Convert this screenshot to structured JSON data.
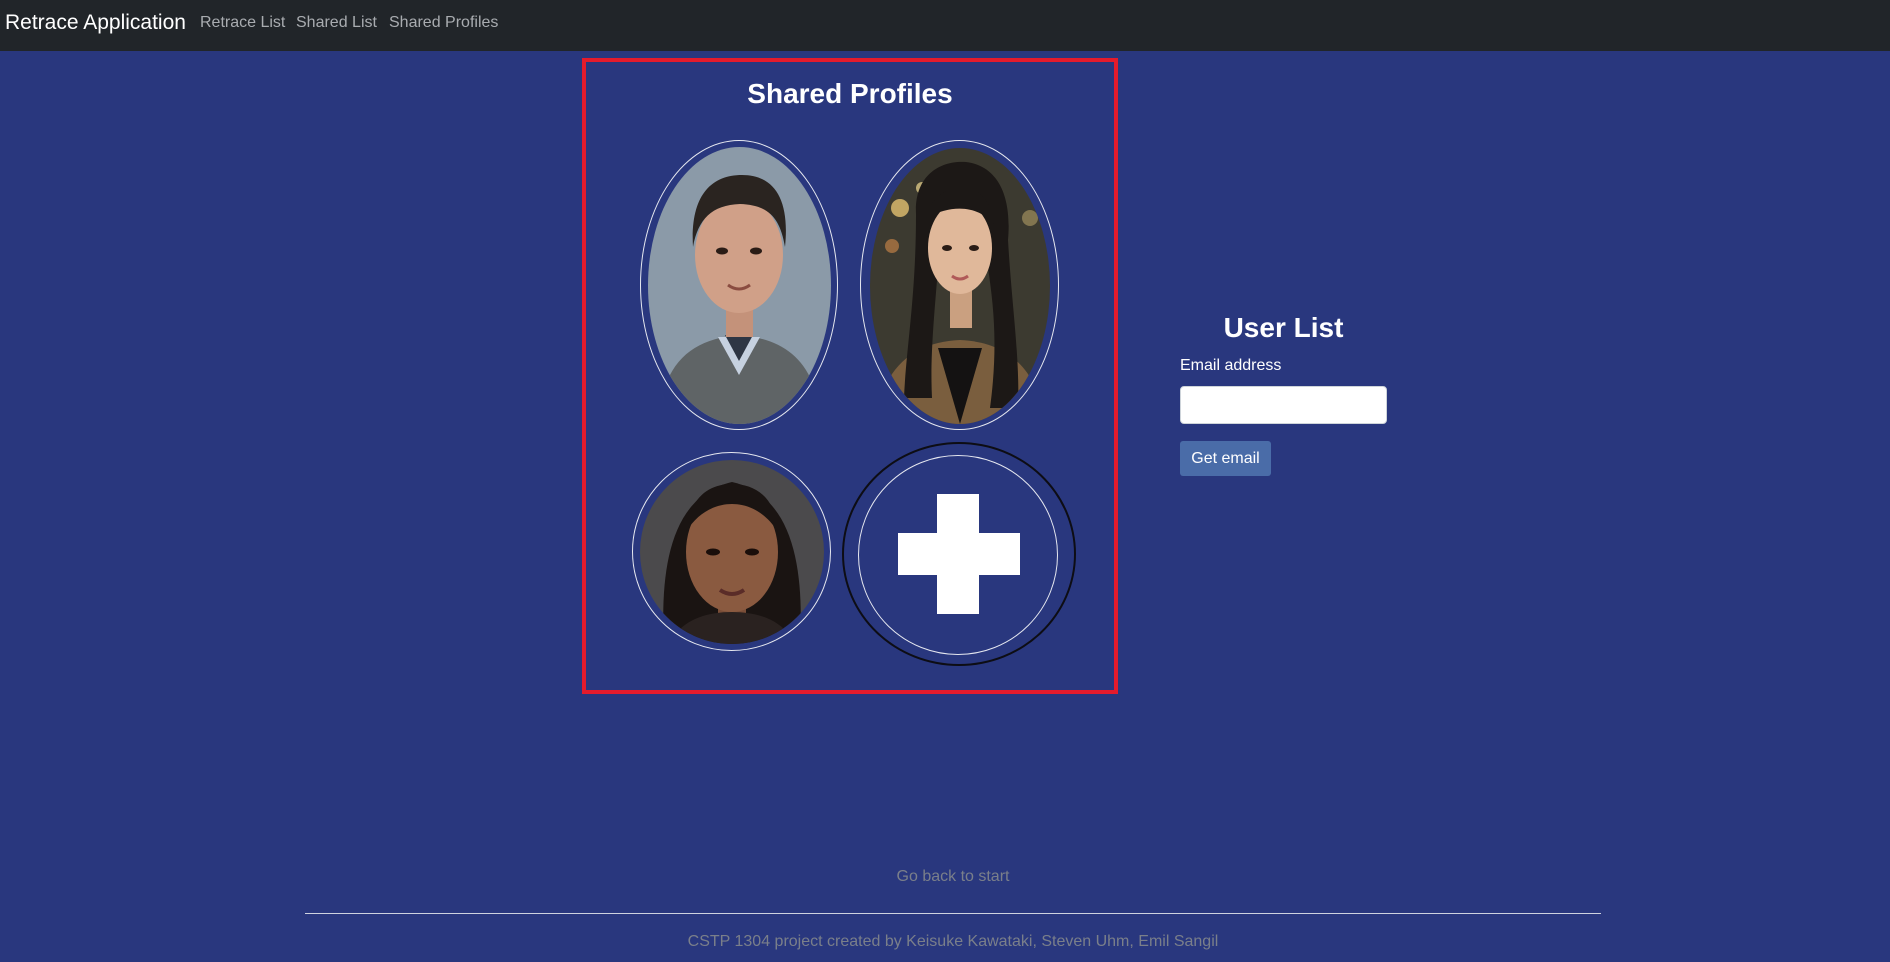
{
  "navbar": {
    "brand": "Retrace Application",
    "links": [
      "Retrace List",
      "Shared List",
      "Shared Profiles"
    ]
  },
  "shared_profiles": {
    "title": "Shared Profiles",
    "profiles": [
      {
        "name": "profile-man",
        "skin": "#d0a088",
        "hair": "#2a2420",
        "clothing": "#5f6466",
        "background": "#8b9aa8"
      },
      {
        "name": "profile-woman-long-hair",
        "skin": "#e0b89a",
        "hair": "#1c1816",
        "clothing": "#7a5e3e",
        "background": "#3c3a30"
      },
      {
        "name": "profile-woman-dark-hair",
        "skin": "#8a5a40",
        "hair": "#1a1412",
        "clothing": "#2a2220",
        "background": "#4b4a4c"
      }
    ],
    "add_button_icon": "plus-icon"
  },
  "user_list": {
    "title": "User List",
    "email_label": "Email address",
    "email_value": "",
    "button_label": "Get email"
  },
  "footer": {
    "back_link": "Go back to start",
    "credits": "CSTP 1304 project created by Keisuke Kawataki, Steven Uhm, Emil Sangil"
  },
  "colors": {
    "page_background": "#29377e",
    "navbar_background": "#212529",
    "panel_border": "#e41b2c",
    "button_background": "#4a6ca8"
  }
}
